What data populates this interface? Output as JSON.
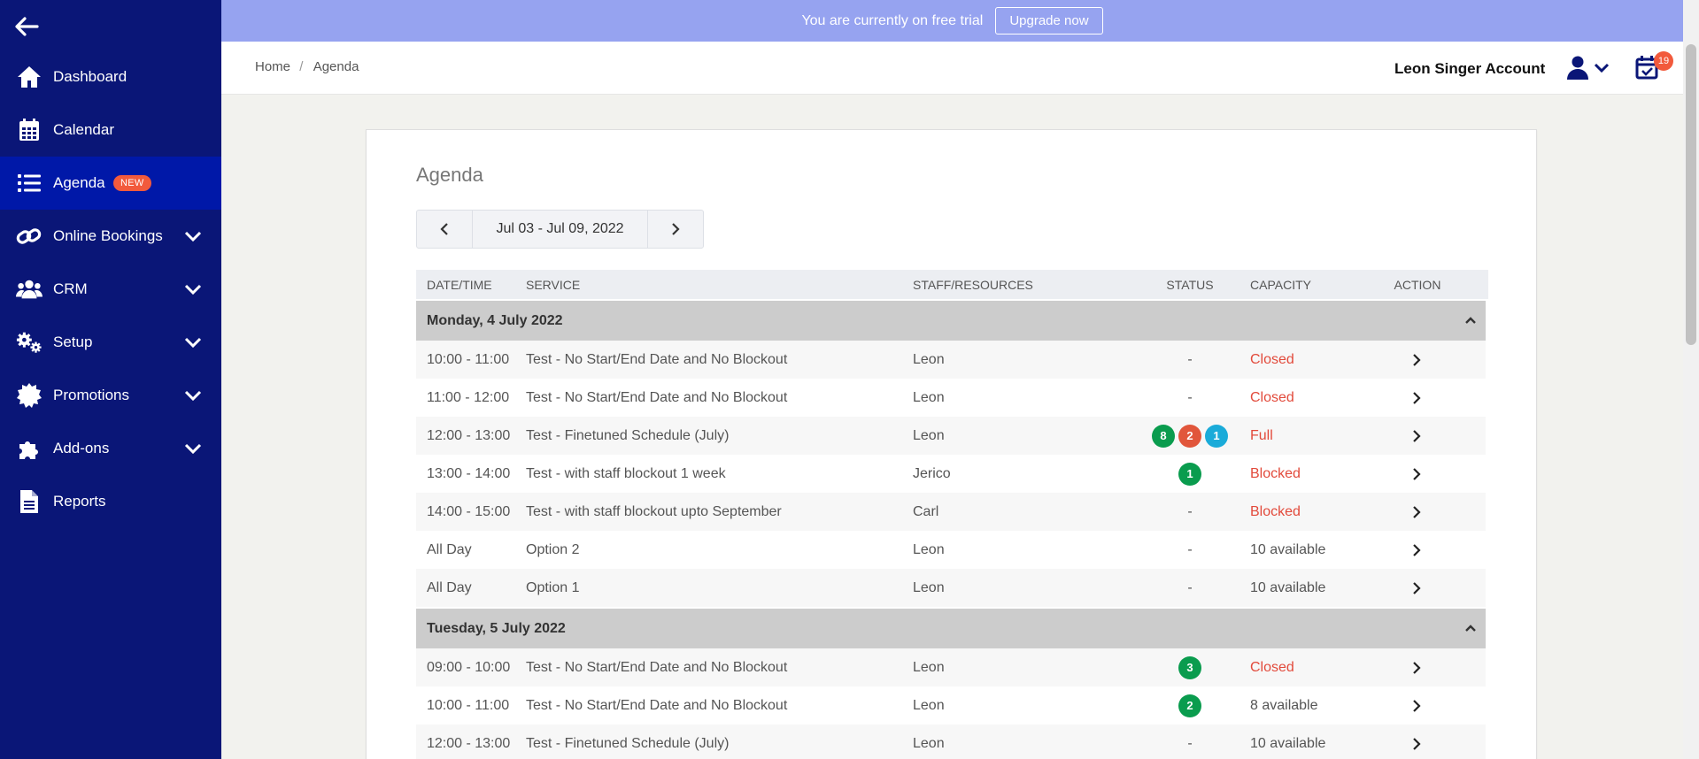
{
  "sidebar": {
    "items": [
      {
        "label": "Dashboard",
        "icon": "home-icon"
      },
      {
        "label": "Calendar",
        "icon": "calendar-grid-icon"
      },
      {
        "label": "Agenda",
        "icon": "list-icon",
        "badge": "NEW"
      },
      {
        "label": "Online Bookings",
        "icon": "link-icon"
      },
      {
        "label": "CRM",
        "icon": "users-icon"
      },
      {
        "label": "Setup",
        "icon": "cogs-icon"
      },
      {
        "label": "Promotions",
        "icon": "badge-icon"
      },
      {
        "label": "Add-ons",
        "icon": "puzzle-icon"
      },
      {
        "label": "Reports",
        "icon": "document-icon"
      }
    ]
  },
  "banner": {
    "text": "You are currently on free trial",
    "button": "Upgrade now"
  },
  "header": {
    "breadcrumb": {
      "home": "Home",
      "sep": "/",
      "current": "Agenda"
    },
    "account_name": "Leon Singer Account",
    "notification_count": "19"
  },
  "main": {
    "title": "Agenda",
    "week_range": "Jul 03 - Jul 09, 2022",
    "columns": [
      "DATE/TIME",
      "SERVICE",
      "STAFF/RESOURCES",
      "STATUS",
      "CAPACITY",
      "ACTION"
    ],
    "groups": [
      {
        "day": "Monday, 4 July 2022",
        "rows": [
          {
            "time": "10:00 - 11:00",
            "service": "Test - No Start/End Date and No Blockout",
            "staff": "Leon",
            "status": "-",
            "capacity": "Closed"
          },
          {
            "time": "11:00 - 12:00",
            "service": "Test - No Start/End Date and No Blockout",
            "staff": "Leon",
            "status": "-",
            "capacity": "Closed"
          },
          {
            "time": "12:00 - 13:00",
            "service": "Test - Finetuned Schedule (July)",
            "staff": "Leon",
            "badges": [
              "8",
              "2",
              "1"
            ],
            "capacity": "Full"
          },
          {
            "time": "13:00 - 14:00",
            "service": "Test - with staff blockout 1 week",
            "staff": "Jerico",
            "badges": [
              "1"
            ],
            "capacity": "Blocked"
          },
          {
            "time": "14:00 - 15:00",
            "service": "Test - with staff blockout upto September",
            "staff": "Carl",
            "status": "-",
            "capacity": "Blocked"
          },
          {
            "time": "All Day",
            "service": "Option 2",
            "staff": "Leon",
            "status": "-",
            "capacity": "10 available"
          },
          {
            "time": "All Day",
            "service": "Option 1",
            "staff": "Leon",
            "status": "-",
            "capacity": "10 available"
          }
        ]
      },
      {
        "day": "Tuesday, 5 July 2022",
        "rows": [
          {
            "time": "09:00 - 10:00",
            "service": "Test - No Start/End Date and No Blockout",
            "staff": "Leon",
            "badges": [
              "3"
            ],
            "capacity": "Closed"
          },
          {
            "time": "10:00 - 11:00",
            "service": "Test - No Start/End Date and No Blockout",
            "staff": "Leon",
            "badges": [
              "2"
            ],
            "capacity": "8 available"
          },
          {
            "time": "12:00 - 13:00",
            "service": "Test - Finetuned Schedule (July)",
            "staff": "Leon",
            "status": "-",
            "capacity": "10 available"
          }
        ]
      }
    ]
  },
  "colors": {
    "sidebar_bg": "#0a1677",
    "sidebar_active": "#0018a8",
    "banner_bg": "#96a3f0",
    "accent_red": "#e24a3b",
    "badge_green": "#0a9c4e",
    "badge_red": "#e1563b",
    "badge_blue": "#1aabd9"
  }
}
